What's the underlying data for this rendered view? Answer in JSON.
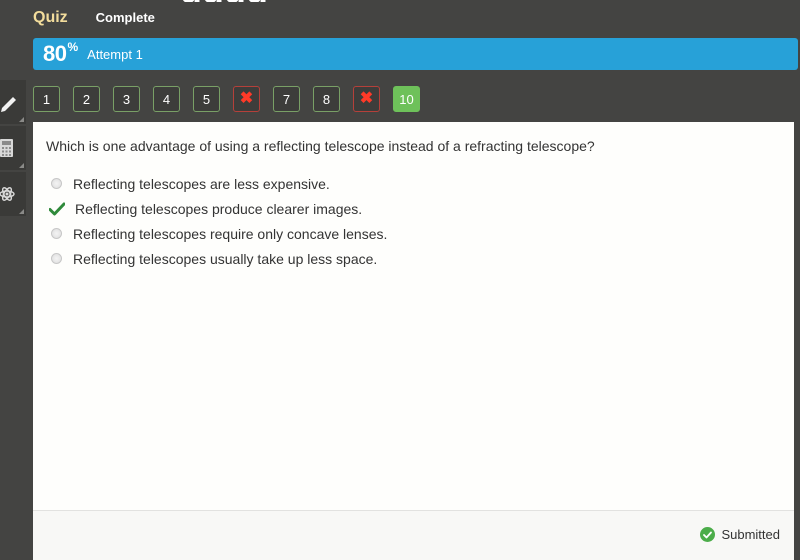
{
  "header": {
    "quiz_label": "Quiz",
    "status": "Complete"
  },
  "score": {
    "value": "80",
    "unit": "%",
    "attempt_label": "Attempt 1",
    "color": "#27a1d8"
  },
  "tools": [
    {
      "name": "pencil-icon"
    },
    {
      "name": "calculator-icon"
    },
    {
      "name": "atom-icon"
    }
  ],
  "question_nav": [
    {
      "label": "1",
      "state": "correct"
    },
    {
      "label": "2",
      "state": "correct"
    },
    {
      "label": "3",
      "state": "correct"
    },
    {
      "label": "4",
      "state": "correct"
    },
    {
      "label": "5",
      "state": "correct"
    },
    {
      "label": "✖",
      "state": "incorrect"
    },
    {
      "label": "7",
      "state": "correct"
    },
    {
      "label": "8",
      "state": "correct"
    },
    {
      "label": "✖",
      "state": "incorrect"
    },
    {
      "label": "10",
      "state": "current"
    }
  ],
  "question": {
    "text": "Which is one advantage of using a reflecting telescope instead of a refracting telescope?",
    "answers": [
      {
        "text": "Reflecting telescopes are less expensive.",
        "selected": false
      },
      {
        "text": "Reflecting telescopes produce clearer images.",
        "selected": true
      },
      {
        "text": "Reflecting telescopes require only concave lenses.",
        "selected": false
      },
      {
        "text": "Reflecting telescopes usually take up less space.",
        "selected": false
      }
    ]
  },
  "footer": {
    "status_text": "Submitted"
  },
  "colors": {
    "correct_border": "#79a066",
    "incorrect_border": "#b5403a",
    "current_bg": "#6ec15a",
    "check_green": "#2f8a3b"
  }
}
